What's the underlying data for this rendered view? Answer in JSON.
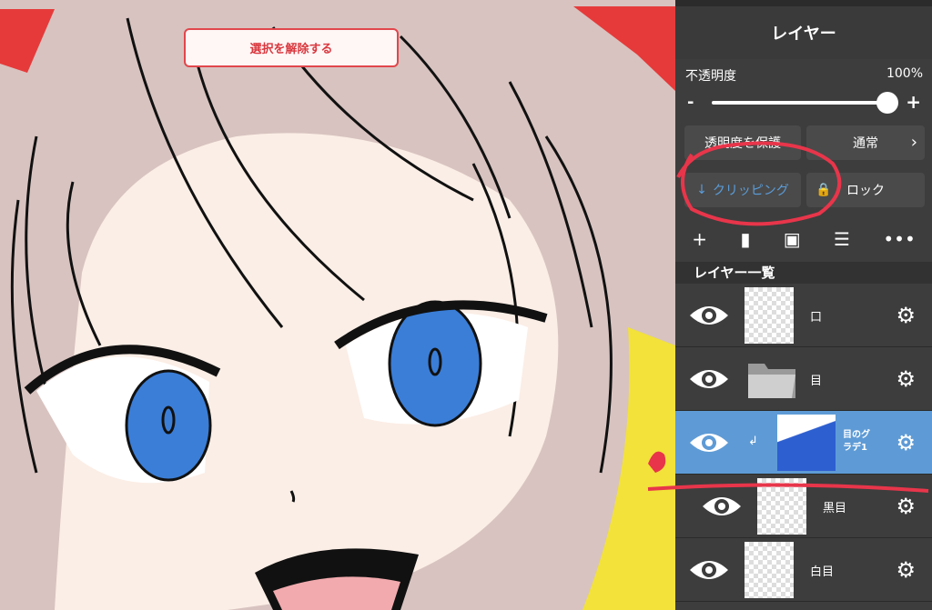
{
  "toast": {
    "label": "選択を解除する"
  },
  "panel": {
    "title": "レイヤー",
    "opacity_label": "不透明度",
    "opacity_value": "100%",
    "opacity_fraction": 1.0,
    "minus": "-",
    "plus": "+",
    "protect_alpha": "透明度を保護",
    "blend_mode": "通常",
    "clipping": "クリッピング",
    "lock": "ロック",
    "layer_list_title": "レイヤー一覧"
  },
  "layers": [
    {
      "name": "口",
      "selected": false,
      "icon": "eye-icon"
    },
    {
      "name": "目",
      "selected": false,
      "icon": "folder-icon"
    },
    {
      "name": "目のグラデ1",
      "selected": true,
      "clipped": true
    },
    {
      "name": "黒目",
      "selected": false
    },
    {
      "name": "白目",
      "selected": false
    }
  ],
  "colors": {
    "accent": "#5e9bd6",
    "panel_bg": "#3d3d3d",
    "annotation": "#e8354a"
  }
}
